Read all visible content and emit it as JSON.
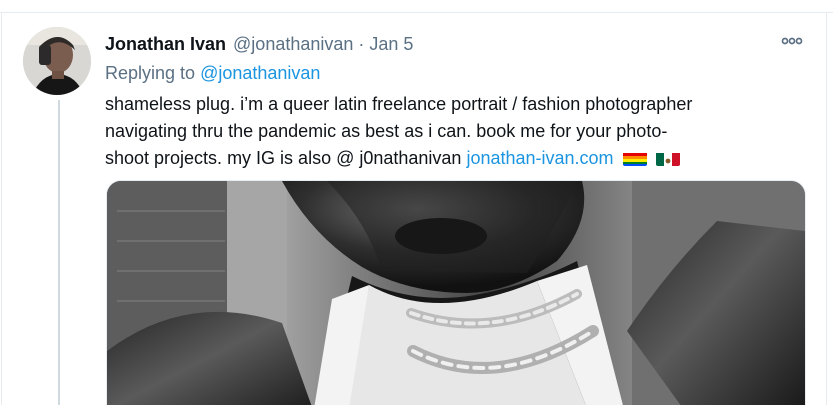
{
  "tweet": {
    "author_name": "Jonathan Ivan",
    "author_handle": "@jonathanivan",
    "separator": "·",
    "date": "Jan 5",
    "reply_prefix": "Replying to ",
    "reply_handle": "@jonathanivan",
    "text_lines": [
      "shameless plug. i’m a queer latin freelance portrait / fashion photographer",
      "navigating thru the pandemic as best as i can. book me for your photo-",
      "shoot projects. my IG is also @ j0nathanivan "
    ],
    "link_text": "jonathan-ivan.com",
    "emoji": [
      "rainbow-flag",
      "mexico-flag"
    ]
  },
  "icons": {
    "more": "more-horizontal-icon",
    "avatar": "profile-photo",
    "media": "black-and-white-portrait-photo"
  },
  "colors": {
    "text": "#0f1419",
    "secondary": "#5b7083",
    "link": "#1b95e0",
    "border": "#e6ecf0",
    "thread_line": "#cfd9de"
  }
}
